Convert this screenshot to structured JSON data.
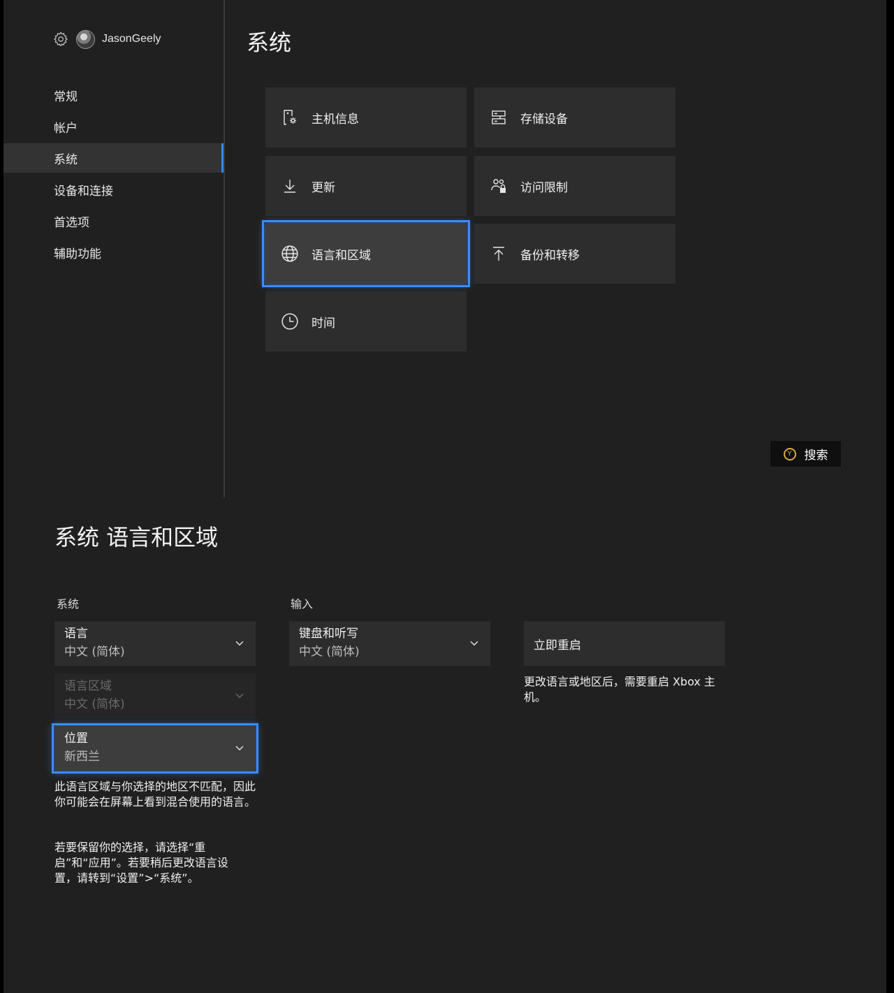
{
  "profile": {
    "username": "JasonGeely"
  },
  "sidebar": {
    "items": [
      {
        "label": "常规"
      },
      {
        "label": "帐户"
      },
      {
        "label": "系统"
      },
      {
        "label": "设备和连接"
      },
      {
        "label": "首选项"
      },
      {
        "label": "辅助功能"
      }
    ],
    "active_index": 2
  },
  "main": {
    "title": "系统",
    "tiles": [
      {
        "label": "主机信息",
        "icon": "console-info-icon"
      },
      {
        "label": "存储设备",
        "icon": "storage-icon"
      },
      {
        "label": "更新",
        "icon": "download-icon"
      },
      {
        "label": "访问限制",
        "icon": "access-lock-icon"
      },
      {
        "label": "语言和区域",
        "icon": "globe-icon"
      },
      {
        "label": "备份和转移",
        "icon": "upload-icon"
      },
      {
        "label": "时间",
        "icon": "clock-icon"
      }
    ],
    "focused_tile": "语言和区域",
    "search_button": {
      "key": "Y",
      "label": "搜索"
    }
  },
  "language_region": {
    "title": "系统 语言和区域",
    "system_section": {
      "label": "系统"
    },
    "input_section": {
      "label": "输入"
    },
    "language": {
      "label": "语言",
      "value": "中文 (简体)"
    },
    "locale": {
      "label": "语言区域",
      "value": "中文 (简体)",
      "disabled": true
    },
    "location": {
      "label": "位置",
      "value": "新西兰"
    },
    "keyboard": {
      "label": "键盘和听写",
      "value": "中文 (简体)"
    },
    "restart_button": "立即重启",
    "restart_note": "更改语言或地区后，需要重启 Xbox 主机。",
    "mismatch_note": "此语言区域与你选择的地区不匹配，因此你可能会在屏幕上看到混合使用的语言。",
    "keep_note": "若要保留你的选择，请选择“重启”和“应用”。若要稍后更改语言设置，请转到“设置”>“系统”。"
  },
  "colors": {
    "background": "#202020",
    "tile": "#2d2d2d",
    "accent": "#3d8bff",
    "y_button": "#d8a94a"
  }
}
